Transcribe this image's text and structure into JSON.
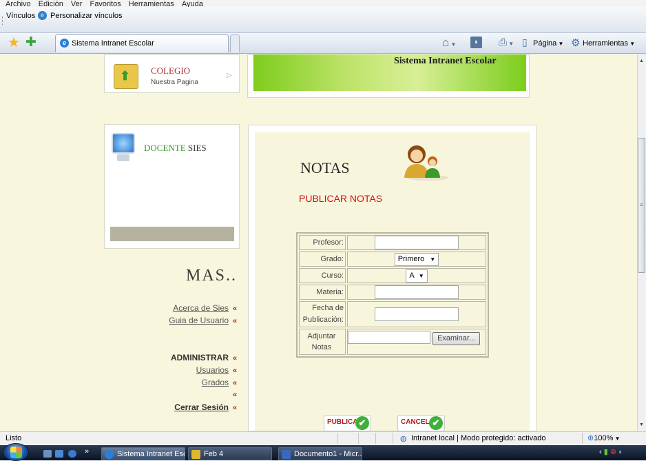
{
  "browser": {
    "menu": [
      "Archivo",
      "Edición",
      "Ver",
      "Favoritos",
      "Herramientas",
      "Ayuda"
    ],
    "links_label": "Vínculos",
    "personalize_links": "Personalizar vínculos",
    "tab_title": "Sistema Intranet Escolar",
    "pagina_label": "Página",
    "herramientas_label": "Herramientas"
  },
  "page": {
    "colegio_title": "COLEGIO",
    "colegio_subtitle": "Nuestra Pagina",
    "banner_title": "Sistema Intranet Escolar",
    "docente_green": "DOCENTE",
    "docente_rest": " SIES",
    "mas_title": "MAS..",
    "links": {
      "acerca": "Acerca de Sies",
      "guia": "Guia de Usuario",
      "administrar": "ADMINISTRAR",
      "usuarios": "Usuarios",
      "grados": "Grados",
      "cerrar": "Cerrar Sesión"
    },
    "raquo": "«",
    "notas_title": "NOTAS",
    "publicar_title": "PUBLICAR NOTAS",
    "form": {
      "profesor_label": "Profesor:",
      "profesor_value": "",
      "grado_label": "Grado:",
      "grado_selected": "Primero",
      "curso_label": "Curso:",
      "curso_selected": "A",
      "materia_label": "Materia:",
      "materia_value": "",
      "fecha_label_1": "Fecha de",
      "fecha_label_2": "Publicación:",
      "fecha_value": "",
      "adjuntar_label_1": "Adjuntar",
      "adjuntar_label_2": "Notas",
      "examinar_label": "Examinar..."
    },
    "publicar_btn": "PUBLICAR",
    "cancelar_btn": "CANCELAR"
  },
  "status": {
    "text": "Listo",
    "zone": "Intranet local | Modo protegido: activado",
    "zoom": "100%"
  },
  "taskbar": {
    "task1": "Sistema Intranet Esc...",
    "task2": "Feb 4",
    "task3": "Documento1 - Micr..."
  },
  "colors": {
    "accent_red": "#cc1515",
    "link_red": "#b02020",
    "page_bg": "#f8f6dc",
    "banner_green": "#7fcc1e"
  }
}
